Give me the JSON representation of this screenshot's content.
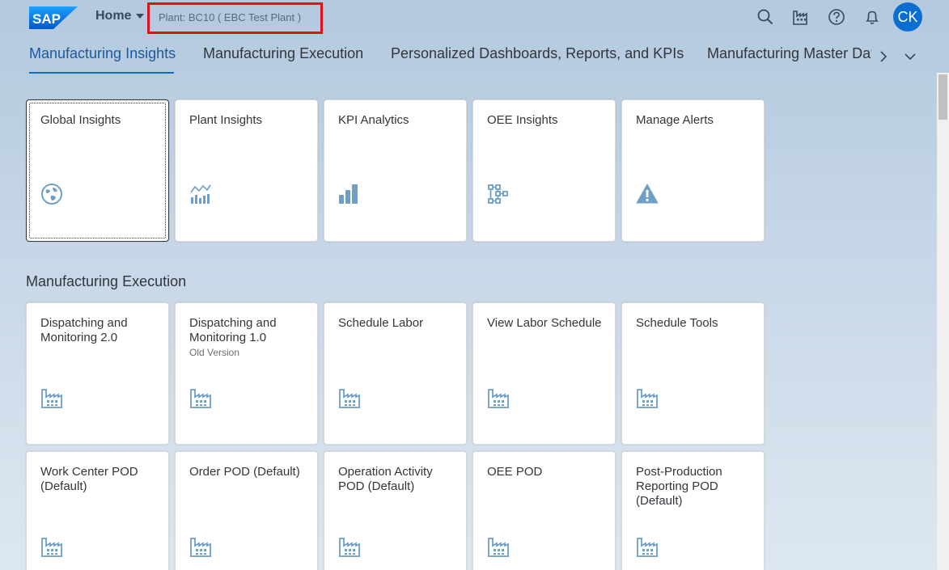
{
  "shell": {
    "logo_text": "SAP",
    "home_label": "Home",
    "plant_label": "Plant: BC10 ( EBC Test Plant )",
    "avatar_initials": "CK",
    "icons": [
      "search-icon",
      "factory-icon",
      "help-icon",
      "notifications-icon"
    ]
  },
  "tabs": [
    {
      "label": "Manufacturing Insights",
      "active": true
    },
    {
      "label": "Manufacturing Execution"
    },
    {
      "label": "Personalized Dashboards, Reports, and KPIs"
    },
    {
      "label": "Manufacturing Master Data"
    }
  ],
  "sections": {
    "insights_tiles": [
      {
        "title": "Global Insights",
        "icon": "globe-icon"
      },
      {
        "title": "Plant Insights",
        "icon": "line-bar-chart-icon"
      },
      {
        "title": "KPI Analytics",
        "icon": "bar-chart-icon"
      },
      {
        "title": "OEE Insights",
        "icon": "network-icon"
      },
      {
        "title": "Manage Alerts",
        "icon": "warning-icon"
      }
    ],
    "execution_title": "Manufacturing Execution",
    "execution_tiles_row1": [
      {
        "title": "Dispatching and Monitoring 2.0",
        "icon": "factory-icon"
      },
      {
        "title": "Dispatching and Monitoring 1.0",
        "subtitle": "Old Version",
        "icon": "factory-icon"
      },
      {
        "title": "Schedule Labor",
        "icon": "factory-icon"
      },
      {
        "title": "View Labor Schedule",
        "icon": "factory-icon"
      },
      {
        "title": "Schedule Tools",
        "icon": "factory-icon"
      }
    ],
    "execution_tiles_row2": [
      {
        "title": "Work Center POD (Default)",
        "icon": "factory-icon"
      },
      {
        "title": "Order POD (Default)",
        "icon": "factory-icon"
      },
      {
        "title": "Operation Activity POD (Default)",
        "icon": "factory-icon"
      },
      {
        "title": "OEE POD",
        "icon": "factory-icon"
      },
      {
        "title": "Post-Production Reporting POD (Default)",
        "icon": "factory-icon"
      }
    ]
  },
  "colors": {
    "accent": "#0a6ed1",
    "highlight_box": "#e0101a",
    "icon": "#6f9ec7"
  }
}
